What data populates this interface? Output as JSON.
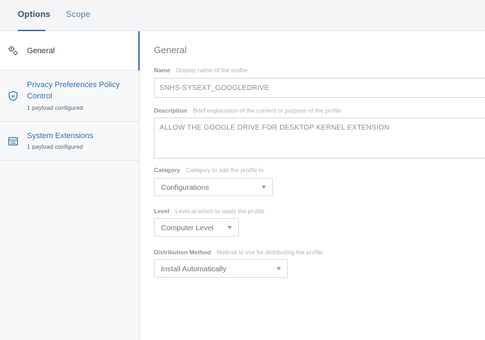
{
  "tabs": [
    {
      "label": "Options",
      "active": true
    },
    {
      "label": "Scope",
      "active": false
    }
  ],
  "sidebar": {
    "items": [
      {
        "label": "General",
        "subtitle": "",
        "icon": "gears-icon",
        "active": true
      },
      {
        "label": "Privacy Preferences Policy Control",
        "label_line1": "Privacy Preferences Policy",
        "label_line2": "Control",
        "subtitle": "1 payload configured",
        "icon": "shield-icon",
        "active": false
      },
      {
        "label": "System Extensions",
        "subtitle": "1 payload configured",
        "icon": "extension-box-icon",
        "active": false
      }
    ]
  },
  "general": {
    "title": "General",
    "name": {
      "label": "Name",
      "hint": "Display name of the profile",
      "value": "SNHS-SYSEXT_GOOGLEDRIVE"
    },
    "description": {
      "label": "Description",
      "hint": "Brief explanation of the content or purpose of the profile",
      "value": "ALLOW THE GOOGLE DRIVE FOR DESKTOP KERNEL EXTENSION"
    },
    "category": {
      "label": "Category",
      "hint": "Category to add the profile to",
      "value": "Configurations"
    },
    "level": {
      "label": "Level",
      "hint": "Level at which to apply the profile",
      "value": "Computer Level"
    },
    "distribution": {
      "label": "Distribution Method",
      "hint": "Method to use for distributing the profile",
      "value": "Install Automatically"
    }
  },
  "colors": {
    "accent": "#3b6fb5",
    "link": "#2f6fb0",
    "sidebar_bg": "#f7f8fa"
  }
}
